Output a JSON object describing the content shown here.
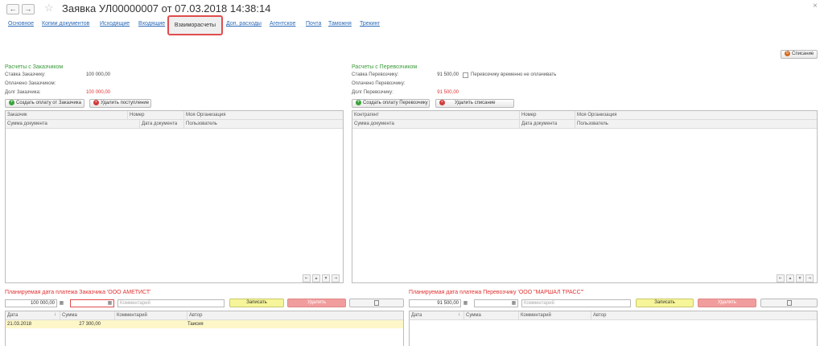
{
  "window": {
    "title": "Заявка УЛ00000007 от 07.03.2018 14:38:14",
    "back_icon": "←",
    "forward_icon": "→",
    "star_icon": "☆",
    "close_icon": "×"
  },
  "tabs": [
    {
      "label": "Основное"
    },
    {
      "label": "Копии документов"
    },
    {
      "label": "Исходящие"
    },
    {
      "label": "Входящие"
    },
    {
      "label": "Взаиморасчеты"
    },
    {
      "label": "Доп. расходы"
    },
    {
      "label": "Агентское"
    },
    {
      "label": "Почта"
    },
    {
      "label": "Таможня"
    },
    {
      "label": "Трекинг"
    }
  ],
  "toolbar": {
    "write_off_label": "Списание"
  },
  "customer": {
    "title": "Расчеты с Заказчиком",
    "rate_label": "Ставка Заказчику:",
    "rate_value": "100 000,00",
    "paid_label": "Оплачено Заказчиком:",
    "debt_label": "Долг Заказчика:",
    "debt_value": "100 000,00",
    "create_payment_label": "Создать оплату от Заказчика",
    "delete_receipt_label": "Удалить поступление",
    "grid": {
      "col1": "Заказчик",
      "col2": "Номер",
      "col3": "Моя Организация",
      "col1b": "Сумма документа",
      "col2b": "Дата документа",
      "col3b": "Пользователь"
    }
  },
  "carrier": {
    "title": "Расчеты с Перевозчиком",
    "rate_label": "Ставка Перевозчику:",
    "rate_value": "91 500,00",
    "temp_unpaid_label": "Перевозчику временно не оплачивать",
    "paid_label": "Оплачено Перевозчику:",
    "debt_label": "Долг Перевозчику:",
    "debt_value": "91 500,00",
    "create_payment_label": "Создать оплату Перевозчику",
    "delete_writeoff_label": "Удалить списание",
    "grid": {
      "col1": "Контрагент",
      "col2": "Номер",
      "col3": "Моя Организация",
      "col1b": "Сумма документа",
      "col2b": "Дата документа",
      "col3b": "Пользователь"
    }
  },
  "plan_customer": {
    "title": "Планируемая дата платежа Заказчика 'ООО АМЕТИСТ'",
    "amount": "100 000,00",
    "comment_placeholder": "Комментарий",
    "save_label": "Записать",
    "delete_label": "Удалить",
    "columns": [
      "Дата",
      "Сумма",
      "Комментарий",
      "Автор"
    ],
    "rows": [
      {
        "date": "21.03.2018",
        "sum": "27 300,00",
        "comment": "",
        "author": "Таисия"
      }
    ]
  },
  "plan_carrier": {
    "title": "Планируемая дата платежа Перевозчику 'ООО \"МАРШАЛ ТРАСС\"'",
    "amount": "91 500,00",
    "comment_placeholder": "Комментарий",
    "save_label": "Записать",
    "delete_label": "Удалить",
    "columns": [
      "Дата",
      "Сумма",
      "Комментарий",
      "Автор"
    ]
  }
}
